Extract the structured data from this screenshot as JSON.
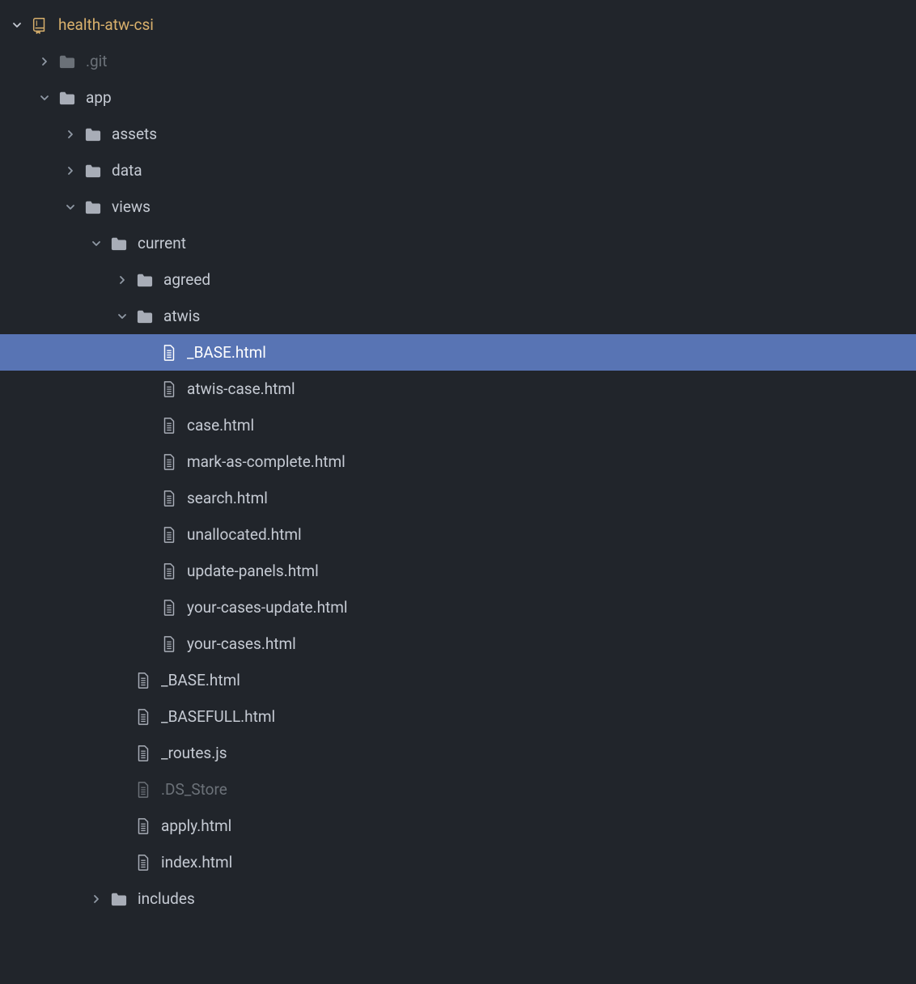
{
  "tree": {
    "root": {
      "name": "health-atw-csi"
    },
    "items": [
      {
        "name": ".git",
        "type": "folder",
        "expanded": false,
        "indent": 1,
        "dimmed": true
      },
      {
        "name": "app",
        "type": "folder",
        "expanded": true,
        "indent": 1
      },
      {
        "name": "assets",
        "type": "folder",
        "expanded": false,
        "indent": 2
      },
      {
        "name": "data",
        "type": "folder",
        "expanded": false,
        "indent": 2
      },
      {
        "name": "views",
        "type": "folder",
        "expanded": true,
        "indent": 2
      },
      {
        "name": "current",
        "type": "folder",
        "expanded": true,
        "indent": 3
      },
      {
        "name": "agreed",
        "type": "folder",
        "expanded": false,
        "indent": 4
      },
      {
        "name": "atwis",
        "type": "folder",
        "expanded": true,
        "indent": 4
      },
      {
        "name": "_BASE.html",
        "type": "file",
        "indent": 5,
        "selected": true
      },
      {
        "name": "atwis-case.html",
        "type": "file",
        "indent": 5
      },
      {
        "name": "case.html",
        "type": "file",
        "indent": 5
      },
      {
        "name": "mark-as-complete.html",
        "type": "file",
        "indent": 5
      },
      {
        "name": "search.html",
        "type": "file",
        "indent": 5
      },
      {
        "name": "unallocated.html",
        "type": "file",
        "indent": 5
      },
      {
        "name": "update-panels.html",
        "type": "file",
        "indent": 5
      },
      {
        "name": "your-cases-update.html",
        "type": "file",
        "indent": 5
      },
      {
        "name": "your-cases.html",
        "type": "file",
        "indent": 5
      },
      {
        "name": "_BASE.html",
        "type": "file",
        "indent": 4
      },
      {
        "name": "_BASEFULL.html",
        "type": "file",
        "indent": 4
      },
      {
        "name": "_routes.js",
        "type": "file",
        "indent": 4
      },
      {
        "name": ".DS_Store",
        "type": "file",
        "indent": 4,
        "dimmed": true
      },
      {
        "name": "apply.html",
        "type": "file",
        "indent": 4
      },
      {
        "name": "index.html",
        "type": "file",
        "indent": 4
      },
      {
        "name": "includes",
        "type": "folder",
        "expanded": false,
        "indent": 3
      }
    ]
  }
}
